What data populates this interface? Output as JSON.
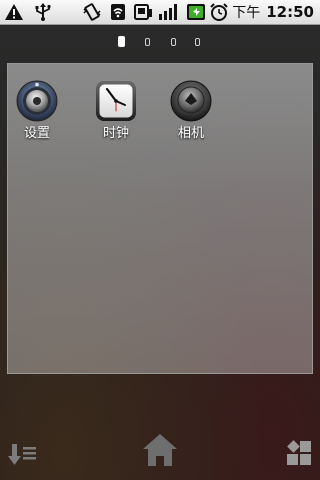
{
  "status_bar": {
    "icons": [
      "warning-icon",
      "usb-icon",
      "vibrate-icon",
      "wifi-icon",
      "sim-icon",
      "signal-icon",
      "battery-icon",
      "alarm-icon"
    ],
    "time_period": "下午",
    "time": "12:50"
  },
  "pager": {
    "total_pages": 4,
    "current_page": 1
  },
  "folder": {
    "apps": [
      {
        "label": "设置",
        "icon": "settings-icon"
      },
      {
        "label": "时钟",
        "icon": "clock-icon"
      },
      {
        "label": "相机",
        "icon": "camera-icon"
      }
    ]
  },
  "dock": {
    "left_icon": "sort-icon",
    "center_icon": "home-icon",
    "right_icon": "app-drawer-icon"
  },
  "colors": {
    "status_bar_bg": "#e8e8e8",
    "folder_bg": "#b0b0b0",
    "label_text": "#ffffff",
    "battery_green": "#3fae2a"
  }
}
